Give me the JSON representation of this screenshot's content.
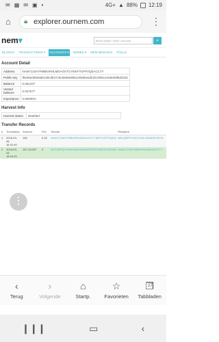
{
  "status": {
    "icons_left": [
      "✉",
      "▦",
      "✉",
      "▣",
      "•"
    ],
    "network": "4G+",
    "battery": "88%",
    "time": "12:19"
  },
  "urlbar": {
    "url": "explorer.ournem.com"
  },
  "site": {
    "logo": "nem",
    "search_placeholder": "Block height / hash / account"
  },
  "nav": [
    {
      "label": "Blocks",
      "active": false
    },
    {
      "label": "Transactions ▾",
      "active": false
    },
    {
      "label": "Accounts ▾",
      "active": true
    },
    {
      "label": "Nodes ▾",
      "active": false
    },
    {
      "label": "NEM Mosaics",
      "active": false
    },
    {
      "label": "Polls",
      "active": false
    }
  ],
  "account_detail": {
    "title": "Account Detail",
    "rows": [
      {
        "label": "Address",
        "value": "NAM7JJ3AYFMBKIRHLMDAOXTCYI6KF7UFPVQEACC7Y"
      },
      {
        "label": "Public key",
        "value": "fb538ed28e8d0128cdb37c8c6669e8951284bbea2b1fe1f5514429eb9f5d2232"
      },
      {
        "label": "Balance",
        "value": "0.061227"
      },
      {
        "label": "Vested balance",
        "value": "0.027577"
      },
      {
        "label": "Importance",
        "value": "0.00000%"
      }
    ]
  },
  "harvest_info": {
    "title": "Harvest Info",
    "rows": [
      {
        "label": "Harvest status",
        "value": "disabled"
      }
    ]
  },
  "transfer_records": {
    "title": "Transfer Records",
    "headers": [
      "#",
      "Timestamp",
      "Amount",
      "Fee",
      "Sender",
      "Recipient"
    ],
    "rows": [
      {
        "n": "1",
        "timestamp": "2018-03-06 16:41:49",
        "amount": "156",
        "fee": "0.25",
        "sender": "NAM7JJ3AYFMBKIRHLMDAOXTCYI6KF7UFPVQEACC7Y",
        "recipient": "NBLQNPETZ3CVXNLIN4NDR7WCN"
      },
      {
        "n": "2",
        "timestamp": "2018-03-03 18:16:29",
        "amount": "157.111257",
        "fee": "2",
        "sender": "NDSJRFQVVKHKAA2H6NV6A75PBTUIB57DGNDI6AWFHNR",
        "recipient": "NAM7JJ3AYFMBKIRHLMDAOXTCY"
      }
    ]
  },
  "browser_bar": [
    {
      "icon": "‹",
      "label": "Terug",
      "disabled": false
    },
    {
      "icon": "›",
      "label": "Volgende",
      "disabled": true
    },
    {
      "icon": "⌂",
      "label": "Startp.",
      "disabled": false
    },
    {
      "icon": "☆",
      "label": "Favorieten",
      "disabled": false
    },
    {
      "icon": "❐",
      "label": "Tabbladen",
      "disabled": false
    }
  ],
  "tab_count": "27",
  "android_nav": [
    "❙❙❙",
    "▭",
    "‹"
  ],
  "colors": {
    "accent": "#41b6c8",
    "highlight_row": "#d7ecd1"
  }
}
